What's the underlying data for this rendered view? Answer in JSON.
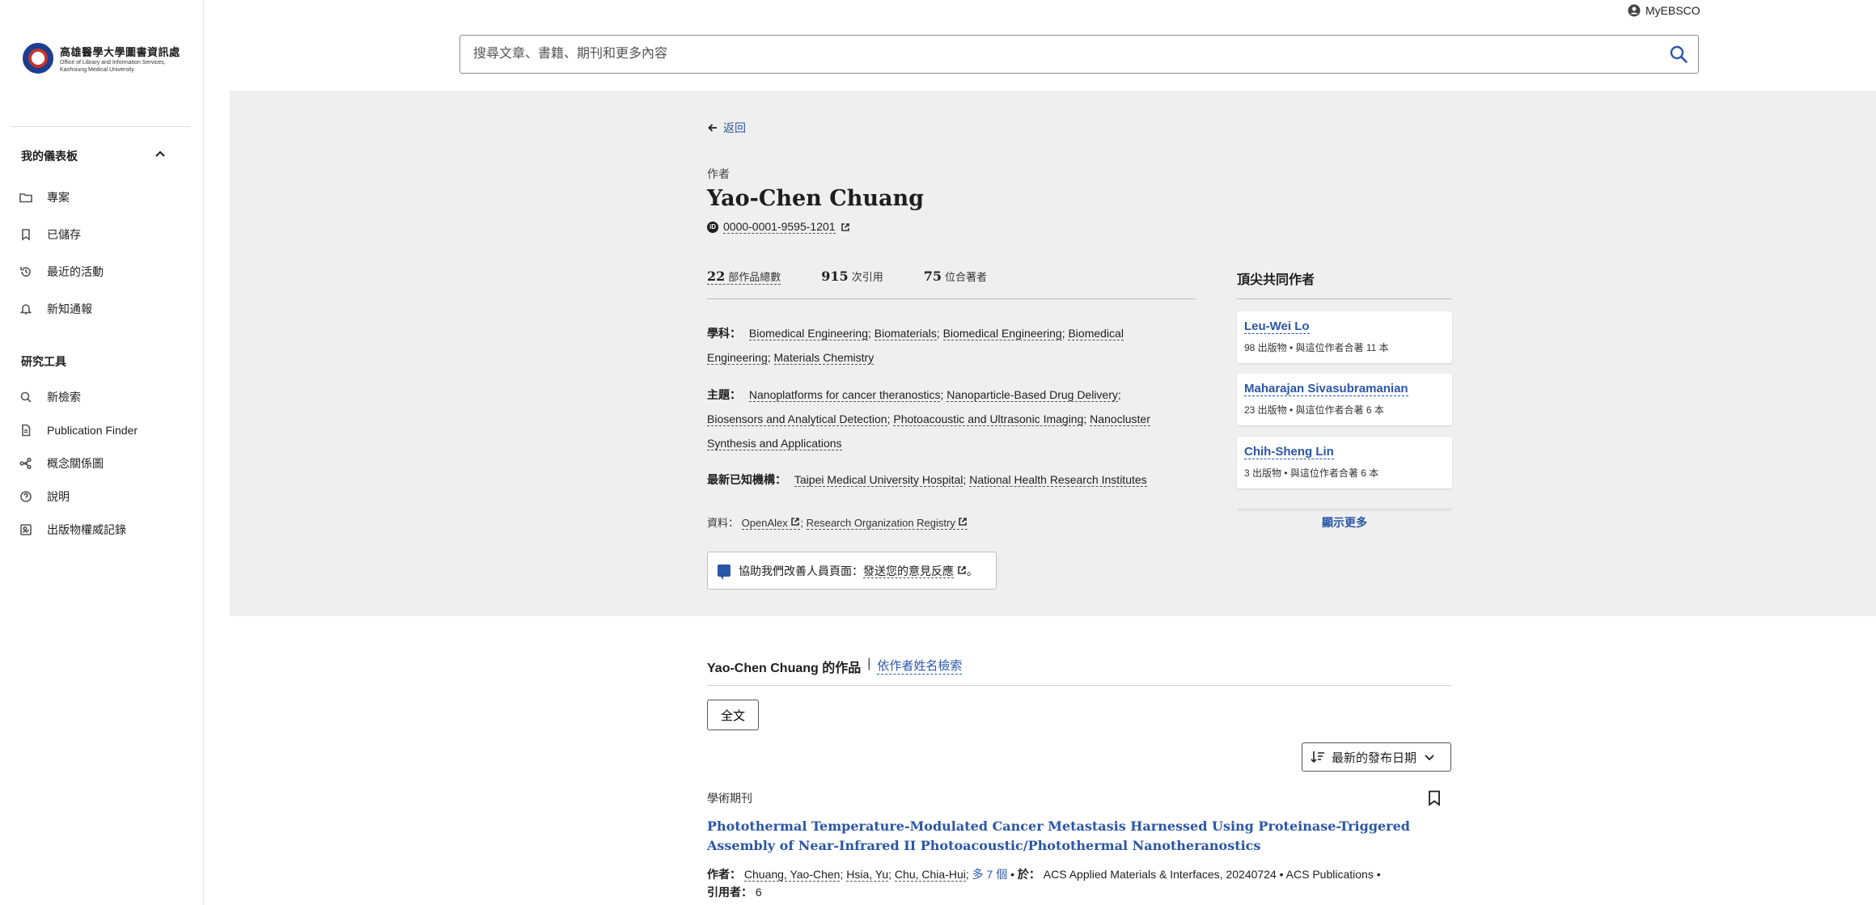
{
  "sidebar": {
    "logo": {
      "line1": "高雄醫學大學圖書資訊處",
      "line2": "Office of Library and Information Services,",
      "line3": "Kaohsiung Medical University"
    },
    "dashboard_title": "我的儀表板",
    "dashboard_items": [
      {
        "label": "專案",
        "icon": "folder-icon"
      },
      {
        "label": "已儲存",
        "icon": "bookmark-icon"
      },
      {
        "label": "最近的活動",
        "icon": "history-icon"
      },
      {
        "label": "新知通報",
        "icon": "bell-icon"
      }
    ],
    "tools_title": "研究工具",
    "tools_items": [
      {
        "label": "新檢索",
        "icon": "search-icon"
      },
      {
        "label": "Publication Finder",
        "icon": "document-icon"
      },
      {
        "label": "概念關係圖",
        "icon": "concept-map-icon"
      },
      {
        "label": "說明",
        "icon": "help-icon"
      },
      {
        "label": "出版物權威記錄",
        "icon": "authority-record-icon"
      }
    ]
  },
  "header": {
    "account_label": "MyEBSCO",
    "search_placeholder": "搜尋文章、書籍、期刊和更多內容"
  },
  "profile": {
    "back_label": "返回",
    "role_label": "作者",
    "name": "Yao-Chen Chuang",
    "orcid": "0000-0001-9595-1201",
    "stats": [
      {
        "value": "22",
        "label": "部作品總數"
      },
      {
        "value": "915",
        "label": "次引用"
      },
      {
        "value": "75",
        "label": "位合著者"
      }
    ],
    "subjects_label": "學科：",
    "subjects": [
      "Biomedical Engineering",
      "Biomaterials",
      "Biomedical Engineering",
      "Biomedical Engineering",
      "Materials Chemistry"
    ],
    "topics_label": "主題：",
    "topics": [
      "Nanoplatforms for cancer theranostics",
      "Nanoparticle-Based Drug Delivery",
      "Biosensors and Analytical Detection",
      "Photoacoustic and Ultrasonic Imaging",
      "Nanocluster Synthesis and Applications"
    ],
    "institutions_label": "最新已知機構：",
    "institutions": [
      "Taipei Medical University Hospital",
      "National Health Research Institutes"
    ],
    "sources_label": "資料：",
    "sources": [
      "OpenAlex",
      "Research Organization Registry"
    ],
    "feedback_prefix": "協助我們改善人員頁面：",
    "feedback_link": "發送您的意見反應",
    "feedback_suffix": "。"
  },
  "coauthors": {
    "title": "頂尖共同作者",
    "items": [
      {
        "name": "Leu-Wei Lo",
        "detail": "98 出版物 • 與這位作者合著 11 本"
      },
      {
        "name": "Maharajan Sivasubramanian",
        "detail": "23 出版物 • 與這位作者合著 6 本"
      },
      {
        "name": "Chih-Sheng Lin",
        "detail": "3 出版物 • 與這位作者合著 6 本"
      }
    ],
    "show_more": "顯示更多"
  },
  "works": {
    "title": "Yao-Chen Chuang 的作品",
    "separator": "|",
    "search_by_name": "依作者姓名檢索",
    "filter_fulltext": "全文",
    "sort_label": "最新的發布日期",
    "articles": [
      {
        "type": "學術期刊",
        "title": "Photothermal Temperature-Modulated Cancer Metastasis Harnessed Using Proteinase-Triggered Assembly of Near-Infrared II Photoacoustic/Photothermal Nanotheranostics",
        "authors_label": "作者：",
        "authors": [
          "Chuang, Yao-Chen",
          "Hsia, Yu",
          "Chu, Chia-Hui"
        ],
        "more_authors": "多 7 個",
        "in_label": "於：",
        "source": "ACS Applied Materials & Interfaces, 20240724 • ACS Publications •",
        "cited_label": "引用者：",
        "cited": "6"
      }
    ]
  }
}
